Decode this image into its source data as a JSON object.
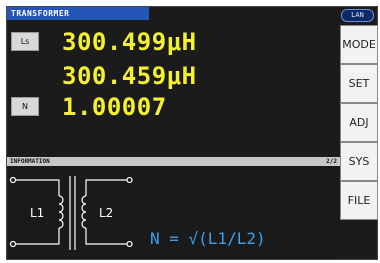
{
  "header": {
    "title": "TRANSFORMER",
    "lan": "LAN"
  },
  "params": [
    {
      "label": "Ls",
      "value": "300.499μH"
    },
    {
      "label": "",
      "value": "300.459μH"
    },
    {
      "label": "N",
      "value": "1.00007"
    }
  ],
  "side_menu": {
    "items": [
      "MODE",
      "SET",
      "ADJ",
      "SYS",
      "FILE"
    ]
  },
  "info": {
    "title": "INFORMATION",
    "page": "2/2",
    "coil_left": "L1",
    "coil_right": "L2",
    "formula": "N = √(L1/L2)"
  },
  "colors": {
    "value": "#f4f22e",
    "title_bar": "#2255b5",
    "formula": "#3aa0f0"
  }
}
